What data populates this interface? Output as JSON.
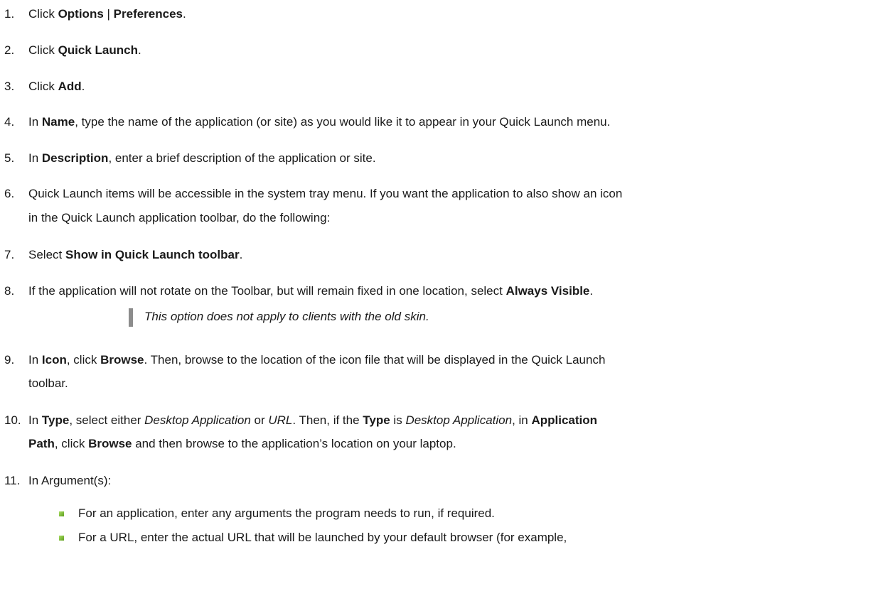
{
  "steps": [
    {
      "num": "1.",
      "parts": [
        "Click ",
        "Options",
        " | ",
        "Preferences",
        "."
      ]
    },
    {
      "num": "2.",
      "parts": [
        "Click ",
        "Quick Launch",
        "."
      ]
    },
    {
      "num": "3.",
      "parts": [
        "Click ",
        "Add",
        "."
      ]
    },
    {
      "num": "4.",
      "parts": [
        "In ",
        "Name",
        ", type the name of the application (or site) as you would like it to appear in your Quick Launch menu."
      ]
    },
    {
      "num": "5.",
      "parts": [
        "In ",
        "Description",
        ", enter a brief description of the application or site."
      ]
    },
    {
      "num": "6.",
      "line1": "Quick Launch items will be accessible in the system tray menu. If you want the application to also show an icon",
      "line2": "in the Quick Launch application toolbar, do the following:"
    },
    {
      "num": "7.",
      "parts": [
        "Select ",
        "Show in Quick Launch toolbar",
        "."
      ]
    },
    {
      "num": "8.",
      "parts": [
        "If the application will not rotate on the Toolbar, but will remain fixed in one location, select ",
        "Always Visible",
        "."
      ]
    },
    {
      "num": "9.",
      "parts": [
        "In ",
        "Icon",
        ", click ",
        "Browse",
        ". Then, browse to the location of the icon file that will be displayed in the Quick Launch"
      ],
      "line2": "toolbar."
    },
    {
      "num": "10.",
      "parts": [
        "In ",
        "Type",
        ", select either ",
        "Desktop Application",
        " or ",
        "URL",
        ". Then, if the ",
        "Type",
        " is ",
        "Desktop Application",
        ", in ",
        "Application"
      ],
      "line2parts": [
        "Path",
        ", click ",
        "Browse",
        " and then browse to the application’s location on your laptop."
      ]
    },
    {
      "num": "11.",
      "parts": [
        "In Argument(s):"
      ]
    }
  ],
  "note": "This option does not apply to clients with the old skin.",
  "bullets": [
    "For an application, enter any arguments the program needs to run, if required.",
    "For a URL, enter the actual URL that will be launched by your default browser (for example,"
  ]
}
